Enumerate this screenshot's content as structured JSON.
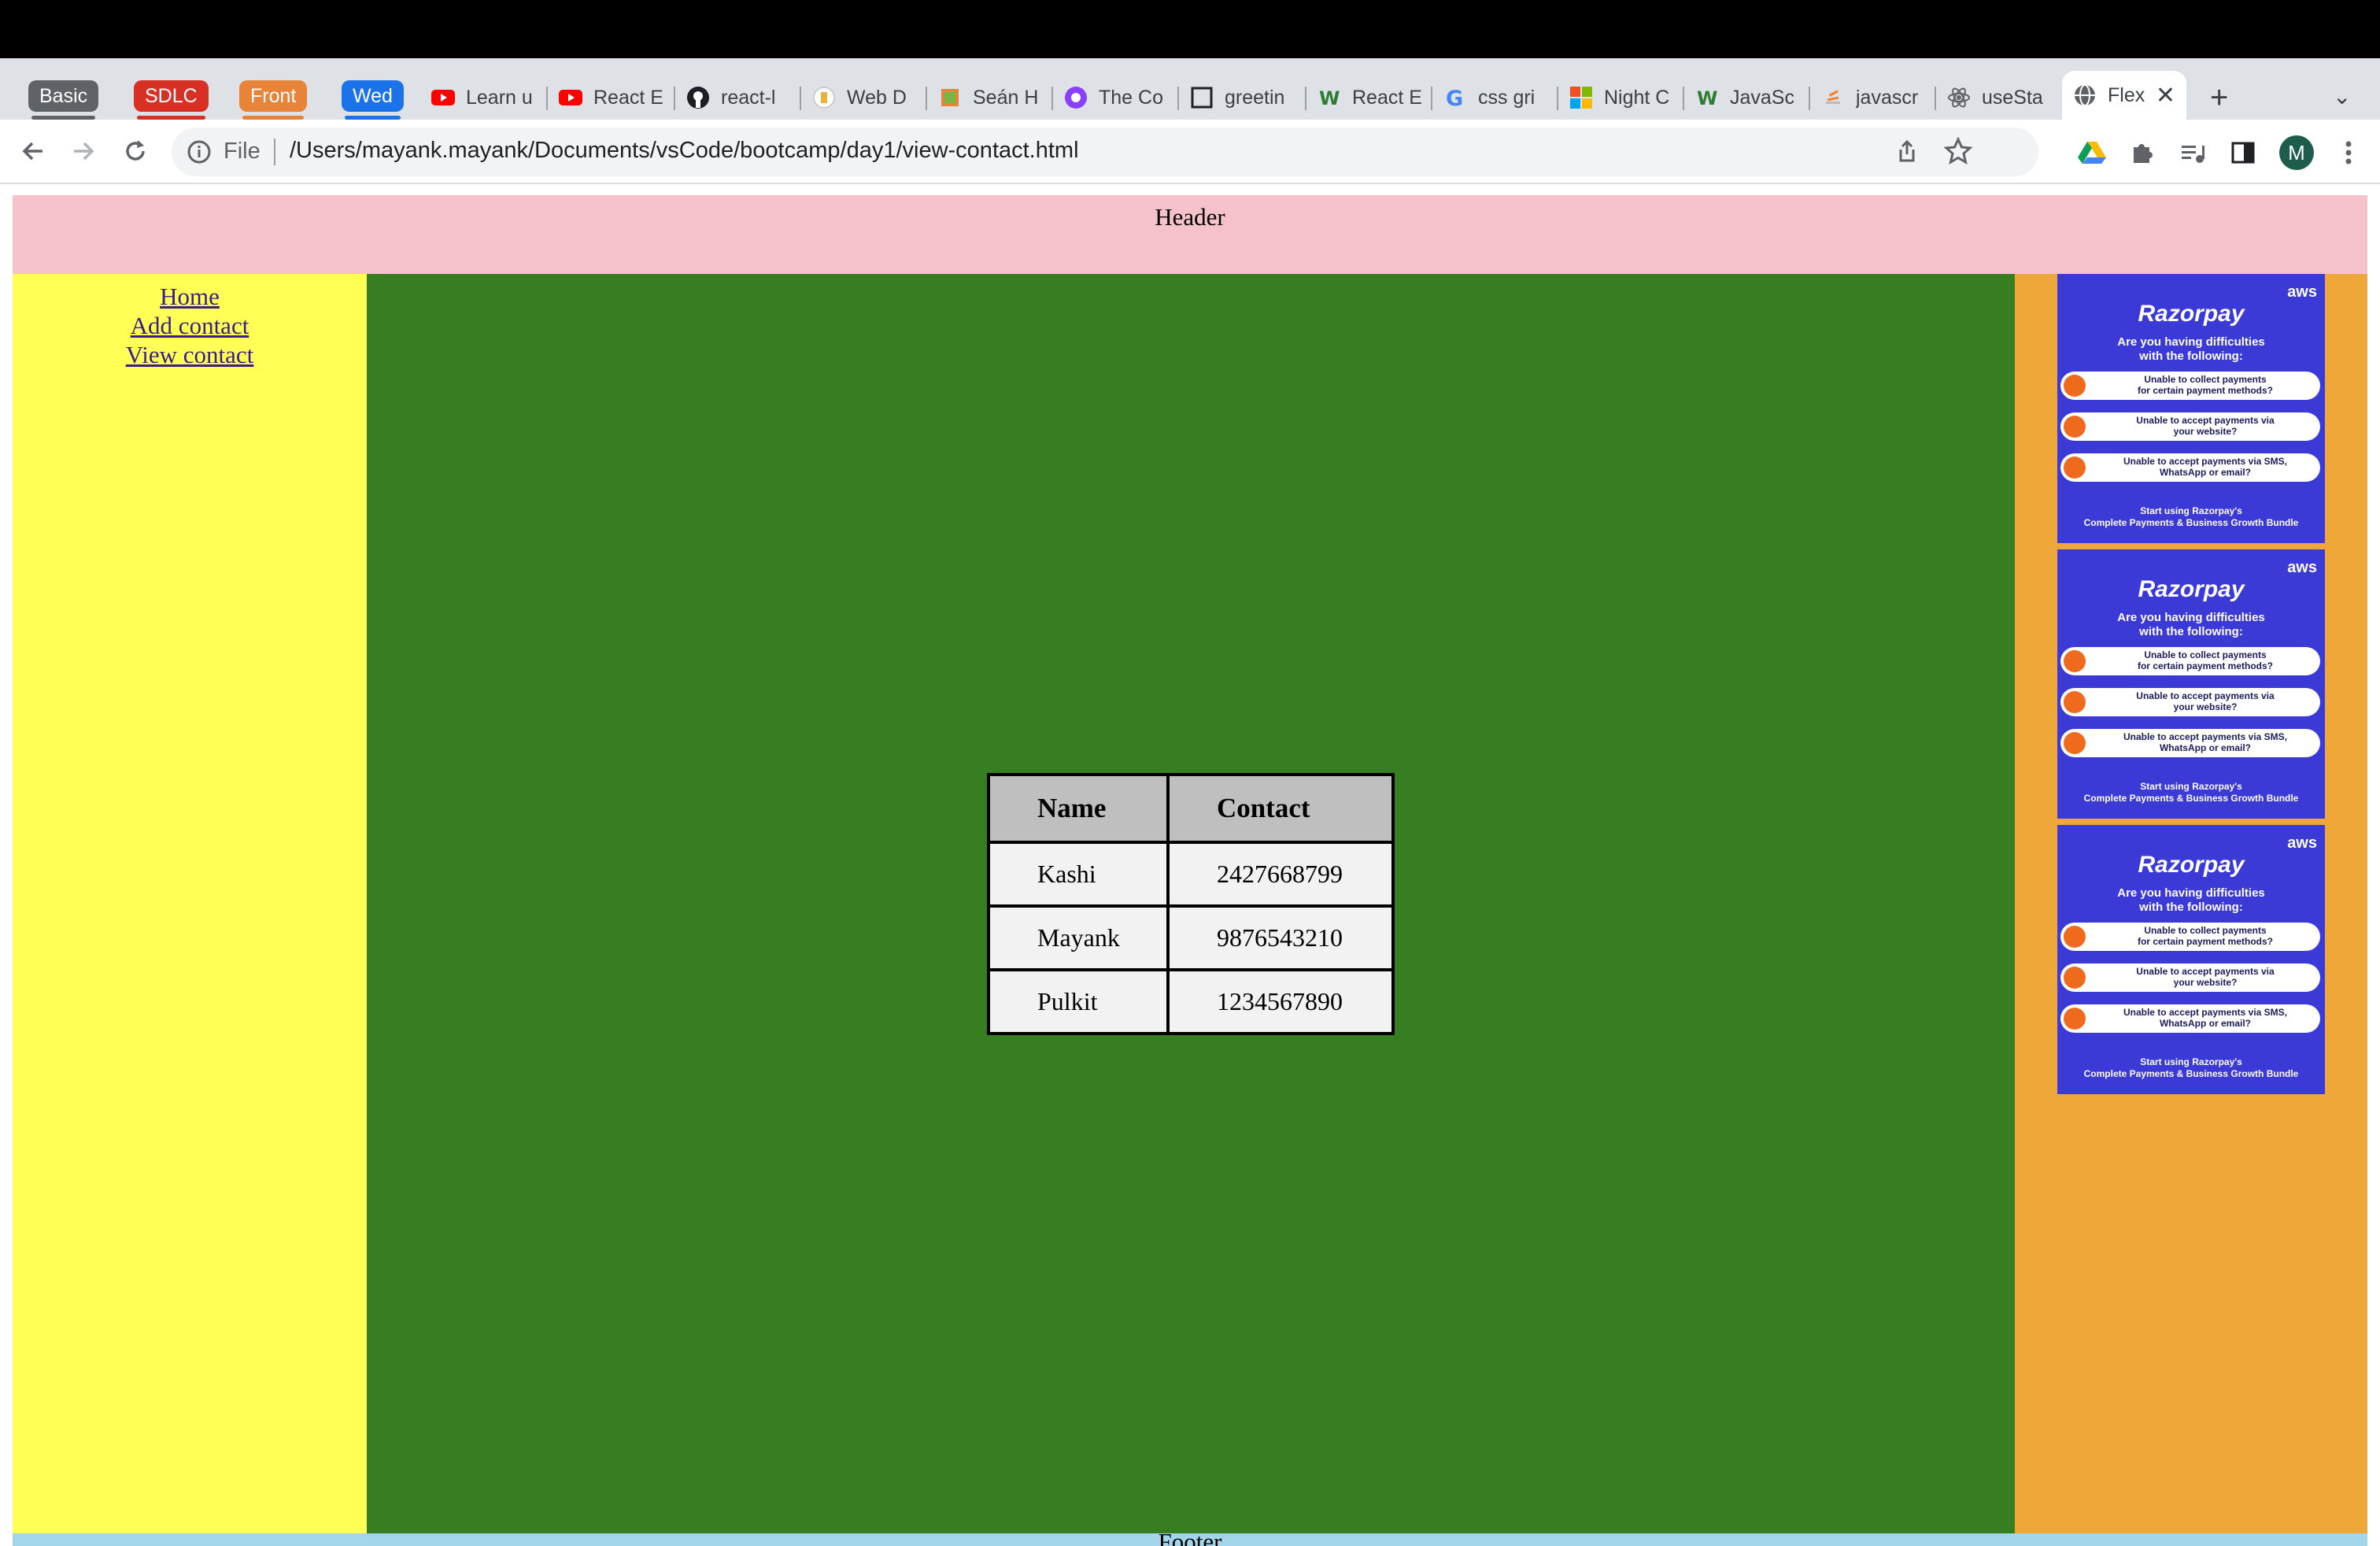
{
  "browser": {
    "tab_groups": [
      {
        "label": "Basic",
        "color": "#5f6368"
      },
      {
        "label": "SDLC",
        "color": "#d93025"
      },
      {
        "label": "Front",
        "color": "#e8843a"
      },
      {
        "label": "Wed",
        "color": "#1a73e8"
      }
    ],
    "tabs": [
      {
        "label": "Learn u",
        "icon": "youtube-icon"
      },
      {
        "label": "React E",
        "icon": "youtube-icon"
      },
      {
        "label": "react-l",
        "icon": "github-icon"
      },
      {
        "label": "Web D",
        "icon": "web-icon"
      },
      {
        "label": "Seán H",
        "icon": "profile-icon"
      },
      {
        "label": "The Co",
        "icon": "purple-circle-icon"
      },
      {
        "label": "greetin",
        "icon": "square-icon"
      },
      {
        "label": "React E",
        "icon": "w-icon"
      },
      {
        "label": "css gri",
        "icon": "google-icon"
      },
      {
        "label": "Night C",
        "icon": "microsoft-icon"
      },
      {
        "label": "JavaSc",
        "icon": "w-icon"
      },
      {
        "label": "javascr",
        "icon": "stackoverflow-icon"
      },
      {
        "label": "useSta",
        "icon": "react-icon"
      }
    ],
    "active_tab": {
      "label": "Flex",
      "icon": "globe-icon"
    },
    "address": {
      "scheme": "File",
      "url": "/Users/mayank.mayank/Documents/vsCode/bootcamp/day1/view-contact.html"
    },
    "profile_initial": "M"
  },
  "page": {
    "header": "Header",
    "footer": "Footer",
    "nav": [
      "Home",
      "Add contact",
      "View contact"
    ],
    "table": {
      "headers": [
        "Name",
        "Contact"
      ],
      "rows": [
        [
          "Kashi",
          "2427668799"
        ],
        [
          "Mayank",
          "9876543210"
        ],
        [
          "Pulkit",
          "1234567890"
        ]
      ]
    },
    "ad": {
      "badge": "aws",
      "brand": "Razorpay",
      "headline_1": "Are you having difficulties",
      "headline_2": "with the following:",
      "items": [
        [
          "Unable to collect payments",
          "for certain payment methods?"
        ],
        [
          "Unable to accept payments via",
          "your website?"
        ],
        [
          "Unable to accept payments via SMS,",
          "WhatsApp or email?"
        ]
      ],
      "cta_1": "Start using Razorpay's",
      "cta_2": "Complete Payments & Business Growth Bundle"
    },
    "colors": {
      "header": "#f5c2cb",
      "sidebar": "#ffff55",
      "main": "#377d22",
      "aside": "#f0a73a",
      "footer": "#a3d6ea"
    }
  }
}
